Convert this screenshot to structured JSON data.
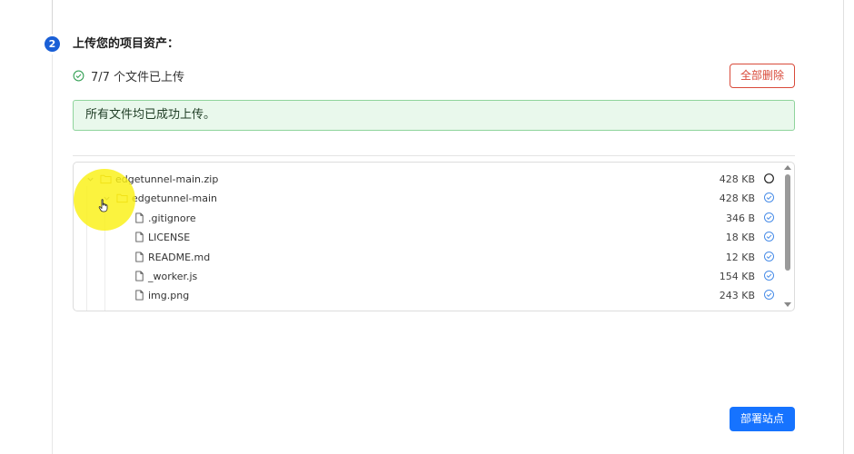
{
  "step": {
    "number": "2",
    "title": "上传您的项目资产："
  },
  "upload_status": {
    "icon": "check-circle-icon",
    "text": "7/7 个文件已上传"
  },
  "buttons": {
    "delete_all": "全部删除",
    "deploy": "部署站点"
  },
  "banner": {
    "message": "所有文件均已成功上传。"
  },
  "files": [
    {
      "name": "edgetunnel-main.zip",
      "size": "428 KB",
      "type": "folder",
      "level": 0,
      "expanded": true,
      "status": "pending"
    },
    {
      "name": "edgetunnel-main",
      "size": "428 KB",
      "type": "folder",
      "level": 1,
      "expanded": true,
      "status": "done"
    },
    {
      "name": ".gitignore",
      "size": "346 B",
      "type": "file",
      "level": 2,
      "status": "done"
    },
    {
      "name": "LICENSE",
      "size": "18 KB",
      "type": "file",
      "level": 2,
      "status": "done"
    },
    {
      "name": "README.md",
      "size": "12 KB",
      "type": "file",
      "level": 2,
      "status": "done"
    },
    {
      "name": "_worker.js",
      "size": "154 KB",
      "type": "file",
      "level": 2,
      "status": "done"
    },
    {
      "name": "img.png",
      "size": "243 KB",
      "type": "file",
      "level": 2,
      "status": "done"
    }
  ],
  "colors": {
    "accent": "#1a5fd6",
    "deploy_button": "#1673ff",
    "danger": "#d94a3a",
    "success_bg": "#e9f8ec",
    "success_border": "#8fd49c",
    "cursor_highlight": "#faf014"
  }
}
